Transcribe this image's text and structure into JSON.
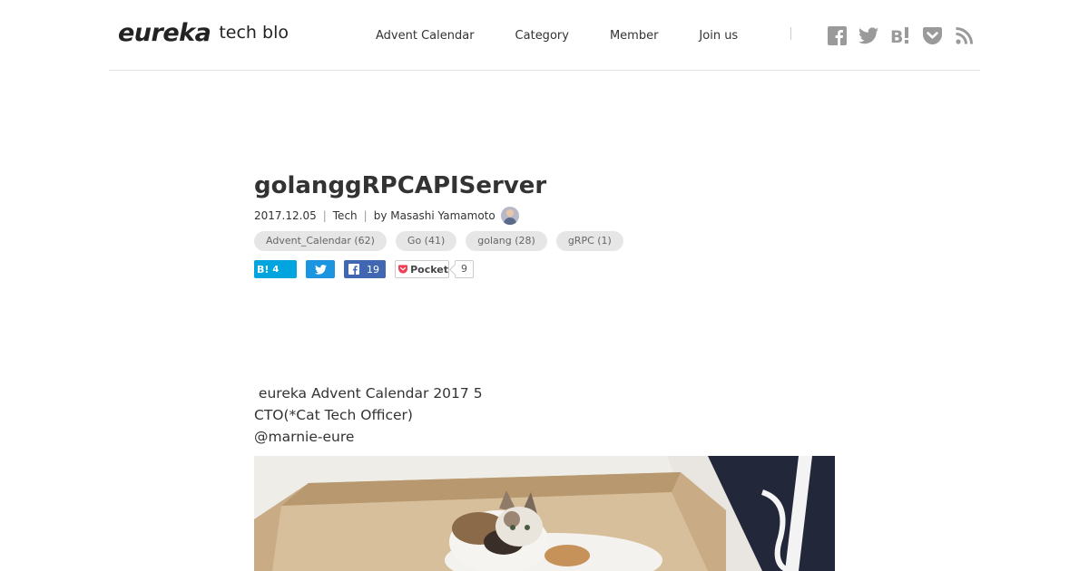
{
  "header": {
    "logo_mark": "eureka",
    "logo_sub": "tech blog",
    "nav": [
      "Advent Calendar",
      "Category",
      "Member",
      "Join us"
    ],
    "social_icons": [
      "facebook-icon",
      "twitter-icon",
      "hatena-bookmark-icon",
      "pocket-icon",
      "rss-icon"
    ]
  },
  "article": {
    "title": "golanggRPCAPIServer",
    "date": "2017.12.05",
    "category": "Tech",
    "author": "by Masashi Yamamoto",
    "tags": [
      "Advent_Calendar (62)",
      "Go (41)",
      "golang (28)",
      "gRPC (1)"
    ],
    "share": {
      "hatena_label": "B!",
      "hatena_count": "4",
      "facebook_count": "19",
      "pocket_label": "Pocket",
      "pocket_count": "9"
    },
    "body_lines": [
      " eureka Advent Calendar 2017 5",
      "CTO(*Cat Tech Officer)",
      "@marnie-eure"
    ]
  },
  "colors": {
    "hatena": "#00a4de",
    "twitter": "#1b95e0",
    "facebook": "#4267b2",
    "pocket": "#ef4056",
    "icon_gray": "#9a9a9a"
  }
}
